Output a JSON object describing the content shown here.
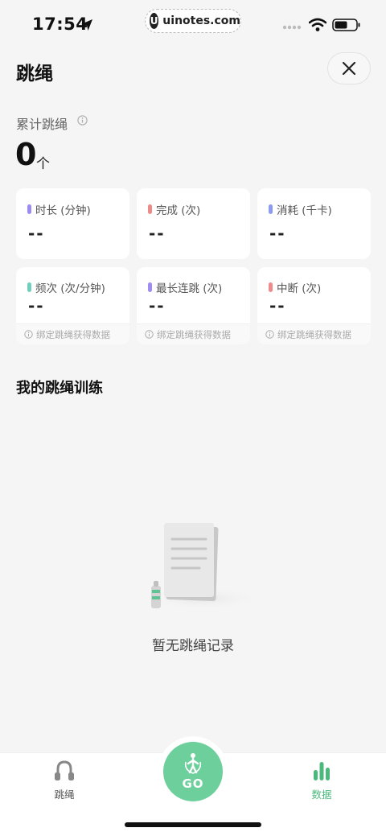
{
  "status_bar": {
    "time": "17:54",
    "watermark_logo": "U",
    "watermark_text": "uinotes.com"
  },
  "header": {
    "title": "跳绳",
    "close_icon": "close-icon"
  },
  "summary": {
    "label": "累计跳绳",
    "value": "0",
    "unit": "个"
  },
  "stats": [
    {
      "label": "时长 (分钟)",
      "value": "--",
      "color": "#9b8cf2"
    },
    {
      "label": "完成 (次)",
      "value": "--",
      "color": "#f08a8a"
    },
    {
      "label": "消耗 (千卡)",
      "value": "--",
      "color": "#8c9bf2"
    },
    {
      "label": "频次 (次/分钟)",
      "value": "--",
      "color": "#6fd0c0",
      "footer": "绑定跳绳获得数据"
    },
    {
      "label": "最长连跳 (次)",
      "value": "--",
      "color": "#a08cf2",
      "footer": "绑定跳绳获得数据"
    },
    {
      "label": "中断 (次)",
      "value": "--",
      "color": "#f08a8a",
      "footer": "绑定跳绳获得数据"
    }
  ],
  "training": {
    "title": "我的跳绳训练",
    "empty_text": "暂无跳绳记录"
  },
  "tabbar": {
    "rope_label": "跳绳",
    "go_label": "GO",
    "data_label": "数据",
    "accent": "#6dcf9c",
    "active_color": "#4bb97c"
  }
}
